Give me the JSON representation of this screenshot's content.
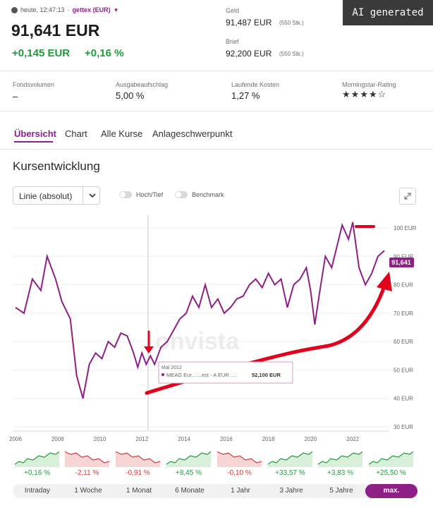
{
  "header": {
    "clock_text": "heute, 12:47:13",
    "dot": "·",
    "exchange": "gettex (EUR)",
    "price": "91,641 EUR",
    "change_abs": "+0,145 EUR",
    "change_pct": "+0,16 %",
    "bid_label": "Geld",
    "bid_value": "91,487 EUR",
    "bid_size": "(550 Stk.)",
    "ask_label": "Brief",
    "ask_value": "92,200 EUR",
    "ask_size": "(550 Stk.)"
  },
  "badge": {
    "text": "AI generated"
  },
  "facts": [
    {
      "label": "Fondsvolumen",
      "value": "–"
    },
    {
      "label": "Ausgabeaufschlag",
      "value": "5,00 %"
    },
    {
      "label": "Laufende Kosten",
      "value": "1,27 %"
    },
    {
      "label": "Morningstar-Rating",
      "stars": 4,
      "max_stars": 5
    }
  ],
  "tabs": [
    {
      "label": "Übersicht",
      "active": true
    },
    {
      "label": "Chart",
      "active": false
    },
    {
      "label": "Alle Kurse",
      "active": false
    },
    {
      "label": "Anlageschwerpunkt",
      "active": false
    }
  ],
  "section_title": "Kursentwicklung",
  "controls": {
    "chart_type": "Linie (absolut)",
    "toggle1_label": "Hoch/Tief",
    "toggle2_label": "Benchmark",
    "toggle1_on": false,
    "toggle2_on": false
  },
  "watermark": "onvista",
  "tooltip": {
    "date": "Mai 2012",
    "series": "MEAG Eur... ...est - A EUR ...:",
    "value": "52,100 EUR"
  },
  "current_price_tag": "91,641",
  "colors": {
    "accent": "#8d1f87",
    "green": "#1f9a3a",
    "red": "#d23b3b",
    "annotation": "#e3001b"
  },
  "chart_data": {
    "type": "line",
    "x_ticks": [
      "2006",
      "2008",
      "2010",
      "2012",
      "2014",
      "2016",
      "2018",
      "2020",
      "2022"
    ],
    "y_ticks": [
      "100 EUR",
      "90 EUR",
      "80 EUR",
      "70 EUR",
      "60 EUR",
      "50 EUR",
      "40 EUR",
      "30 EUR"
    ],
    "ylim": [
      30,
      100
    ],
    "xlim": [
      2006,
      2023.6
    ],
    "series": [
      {
        "x": [
          2006.0,
          2006.4,
          2006.8,
          2007.2,
          2007.5,
          2007.9,
          2008.2,
          2008.6,
          2008.9,
          2009.2,
          2009.5,
          2009.8,
          2010.1,
          2010.4,
          2010.7,
          2011.0,
          2011.3,
          2011.6,
          2011.8,
          2012.0,
          2012.2,
          2012.4,
          2012.6,
          2012.9,
          2013.2,
          2013.5,
          2013.8,
          2014.1,
          2014.4,
          2014.7,
          2015.0,
          2015.3,
          2015.6,
          2015.9,
          2016.2,
          2016.5,
          2016.8,
          2017.1,
          2017.4,
          2017.7,
          2018.0,
          2018.3,
          2018.6,
          2018.9,
          2019.2,
          2019.5,
          2019.8,
          2020.0,
          2020.2,
          2020.4,
          2020.7,
          2021.0,
          2021.3,
          2021.5,
          2021.8,
          2022.0,
          2022.3,
          2022.6,
          2022.9,
          2023.2,
          2023.5
        ],
        "y": [
          72,
          70,
          82,
          78,
          90,
          82,
          74,
          68,
          48,
          40,
          52,
          56,
          54,
          60,
          58,
          63,
          62,
          56,
          51,
          56,
          52,
          55,
          52,
          58,
          60,
          64,
          68,
          70,
          76,
          72,
          80,
          72,
          75,
          70,
          72,
          75,
          76,
          80,
          82,
          79,
          84,
          80,
          82,
          72,
          80,
          82,
          86,
          78,
          66,
          76,
          90,
          86,
          95,
          101,
          96,
          102,
          86,
          80,
          84,
          90,
          92
        ]
      }
    ]
  },
  "mini_charts": [
    {
      "label": "+0,16 %",
      "trend": "up"
    },
    {
      "label": "-2,11 %",
      "trend": "down"
    },
    {
      "label": "-0,91 %",
      "trend": "down"
    },
    {
      "label": "+8,45 %",
      "trend": "up"
    },
    {
      "label": "-0,10 %",
      "trend": "down"
    },
    {
      "label": "+33,57 %",
      "trend": "up"
    },
    {
      "label": "+3,83 %",
      "trend": "up"
    },
    {
      "label": "+25,50 %",
      "trend": "up"
    }
  ],
  "ranges": [
    {
      "label": "Intraday",
      "active": false
    },
    {
      "label": "1 Woche",
      "active": false
    },
    {
      "label": "1 Monat",
      "active": false
    },
    {
      "label": "6 Monate",
      "active": false
    },
    {
      "label": "1 Jahr",
      "active": false
    },
    {
      "label": "3 Jahre",
      "active": false
    },
    {
      "label": "5 Jahre",
      "active": false
    },
    {
      "label": "max.",
      "active": true
    }
  ]
}
